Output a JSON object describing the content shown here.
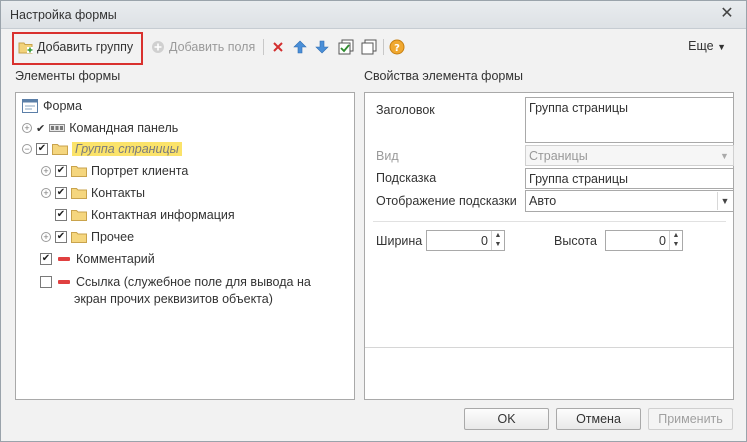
{
  "window": {
    "title": "Настройка формы"
  },
  "toolbar": {
    "add_group": "Добавить группу",
    "add_fields": "Добавить поля",
    "more": "Еще"
  },
  "left": {
    "header": "Элементы формы",
    "tree": [
      {
        "label": "Форма"
      },
      {
        "label": "Командная панель"
      },
      {
        "label": "Группа страницы"
      },
      {
        "label": "Портрет клиента"
      },
      {
        "label": "Контакты"
      },
      {
        "label": "Контактная информация"
      },
      {
        "label": "Прочее"
      },
      {
        "label": "Комментарий"
      },
      {
        "label": "Ссылка (служебное поле для вывода на"
      },
      {
        "label": "экран прочих реквизитов объекта)"
      }
    ]
  },
  "right": {
    "header": "Свойства элемента формы",
    "title_label": "Заголовок",
    "title_value": "Группа страницы",
    "view_label": "Вид",
    "view_value": "Страницы",
    "tooltip_label": "Подсказка",
    "tooltip_value": "Группа страницы",
    "tooltip_display_label": "Отображение подсказки",
    "tooltip_display_value": "Авто",
    "width_label": "Ширина",
    "width_value": "0",
    "height_label": "Высота",
    "height_value": "0"
  },
  "footer": {
    "ok": "OK",
    "cancel": "Отмена",
    "apply": "Применить"
  }
}
